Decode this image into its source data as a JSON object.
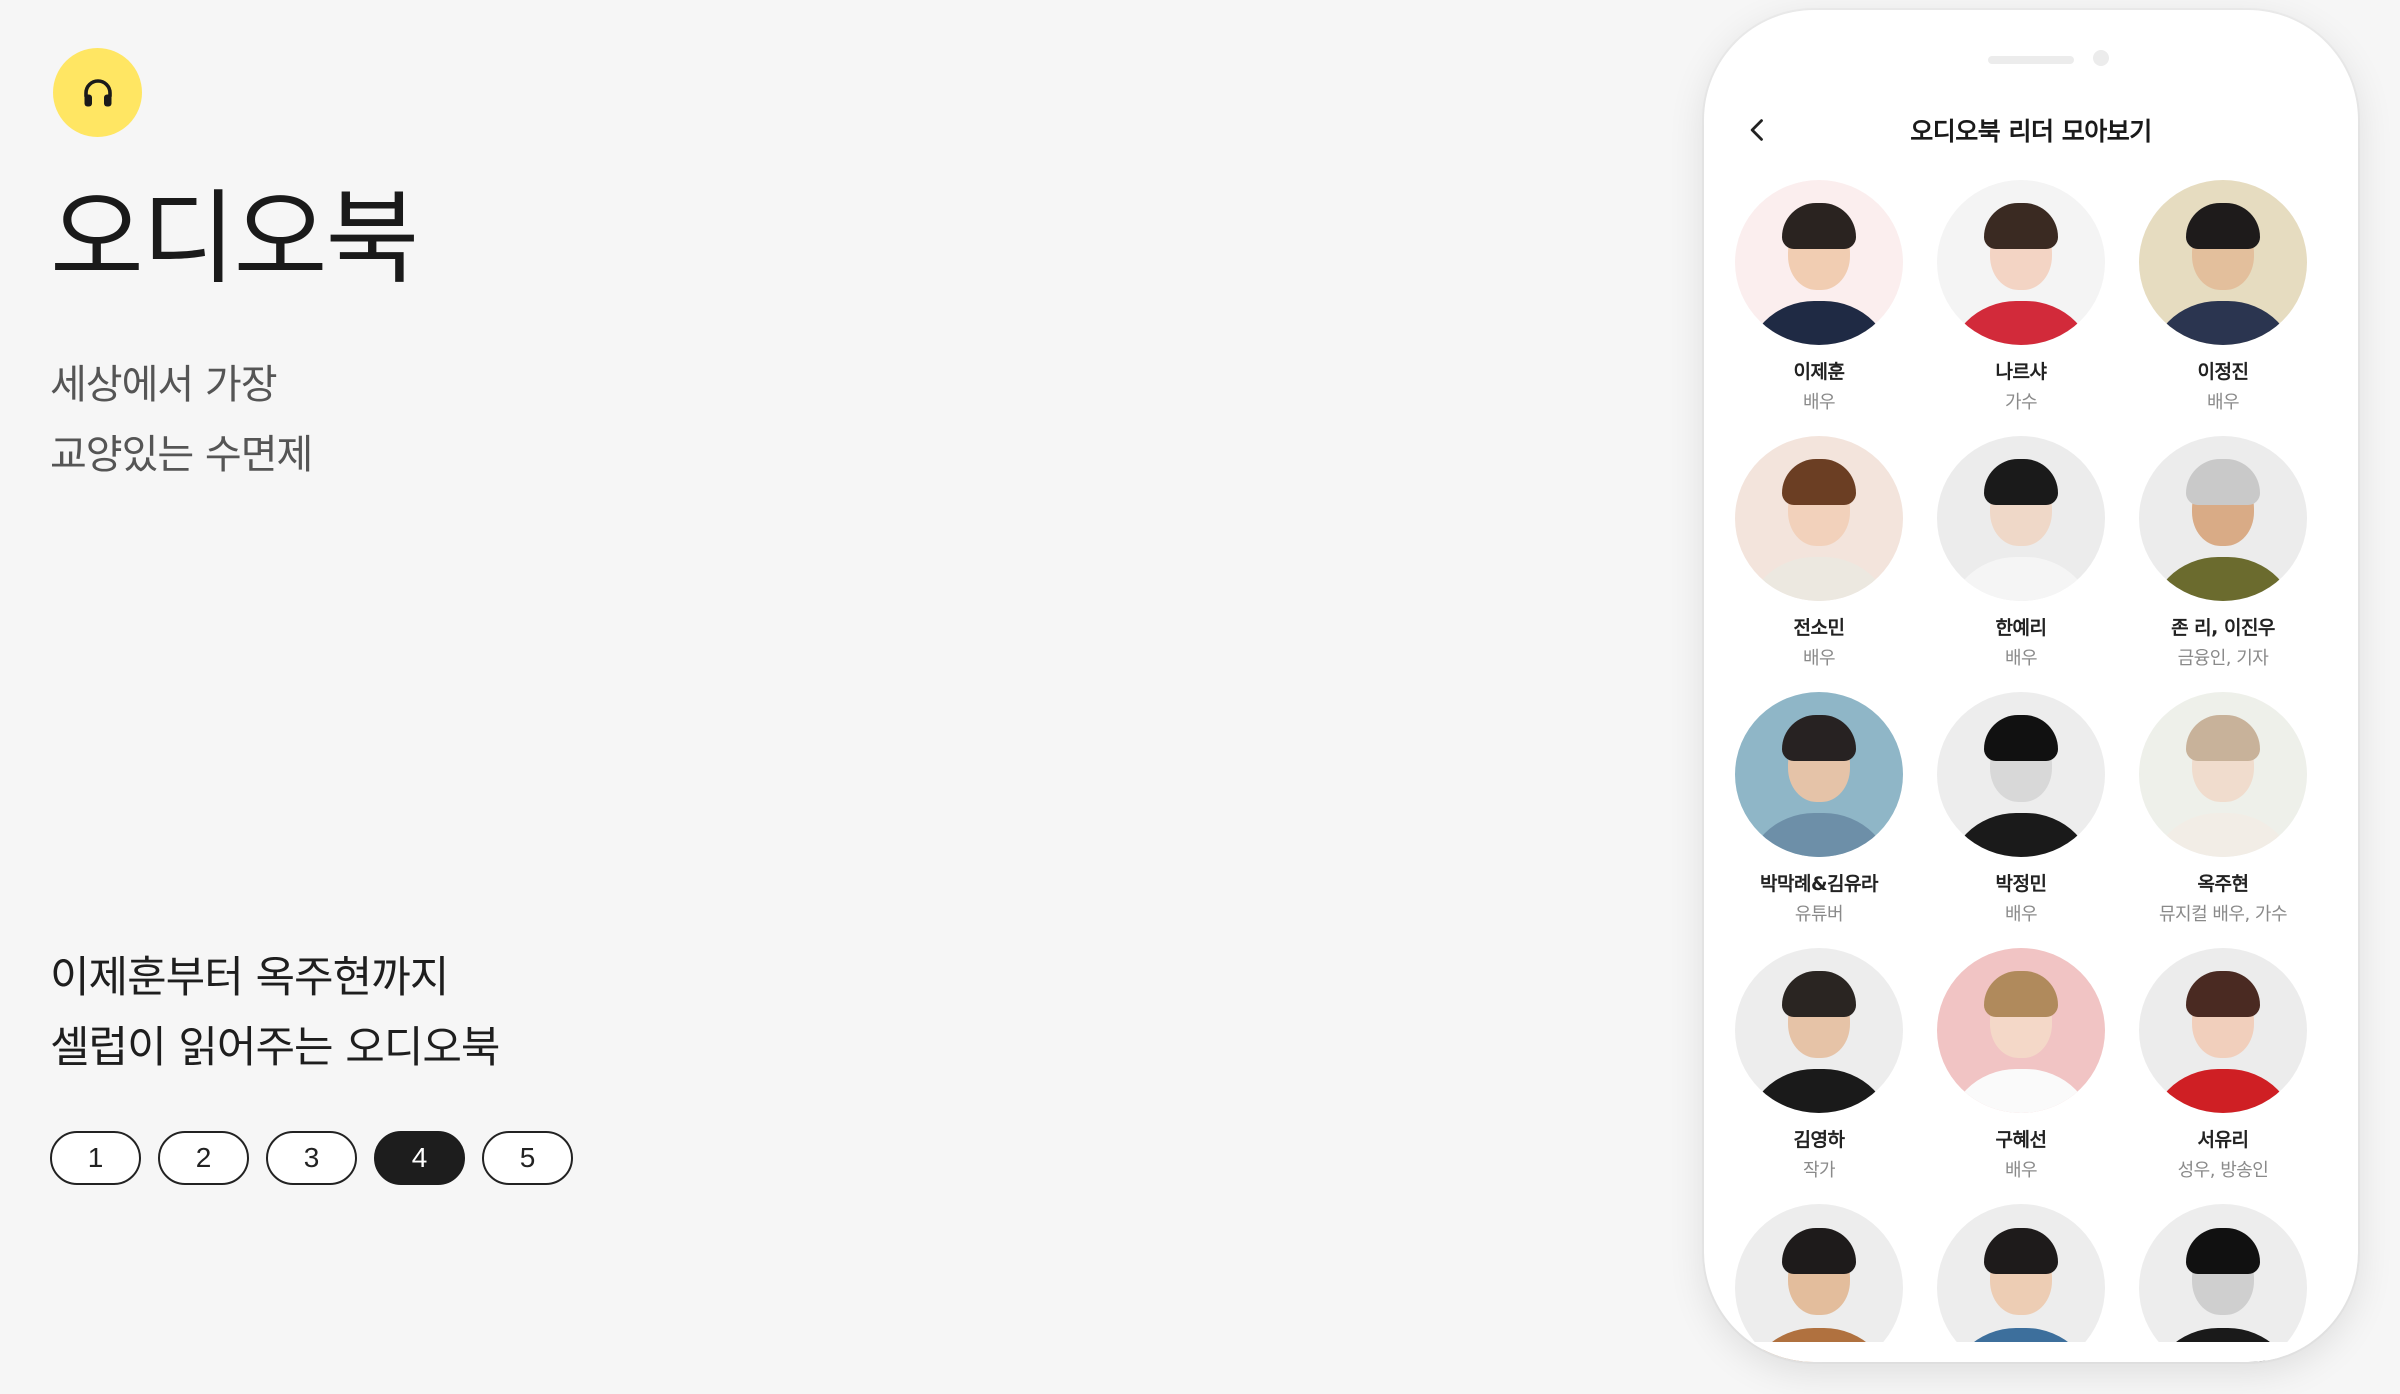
{
  "icons": {
    "badge": "headphones-icon",
    "back": "chevron-left-icon"
  },
  "colors": {
    "accent": "#ffe663",
    "active_page": "#1d1d1d"
  },
  "hero": {
    "title": "오디오북",
    "subtitle_line1": "세상에서 가장",
    "subtitle_line2": "교양있는 수면제"
  },
  "promo": {
    "line1": "이제훈부터 옥주현까지",
    "line2": "셀럽이 읽어주는 오디오북"
  },
  "pager": {
    "pages": [
      "1",
      "2",
      "3",
      "4",
      "5"
    ],
    "active": "4"
  },
  "phone": {
    "title": "오디오북 리더 모아보기",
    "readers": [
      {
        "name": "이제훈",
        "role": "배우"
      },
      {
        "name": "나르샤",
        "role": "가수"
      },
      {
        "name": "이정진",
        "role": "배우"
      },
      {
        "name": "전소민",
        "role": "배우"
      },
      {
        "name": "한예리",
        "role": "배우"
      },
      {
        "name": "존 리, 이진우",
        "role": "금융인, 기자"
      },
      {
        "name": "박막례&김유라",
        "role": "유튜버"
      },
      {
        "name": "박정민",
        "role": "배우"
      },
      {
        "name": "옥주현",
        "role": "뮤지컬 배우, 가수"
      },
      {
        "name": "김영하",
        "role": "작가"
      },
      {
        "name": "구혜선",
        "role": "배우"
      },
      {
        "name": "서유리",
        "role": "성우, 방송인"
      },
      {
        "name": "",
        "role": ""
      },
      {
        "name": "",
        "role": ""
      },
      {
        "name": "",
        "role": ""
      }
    ]
  }
}
